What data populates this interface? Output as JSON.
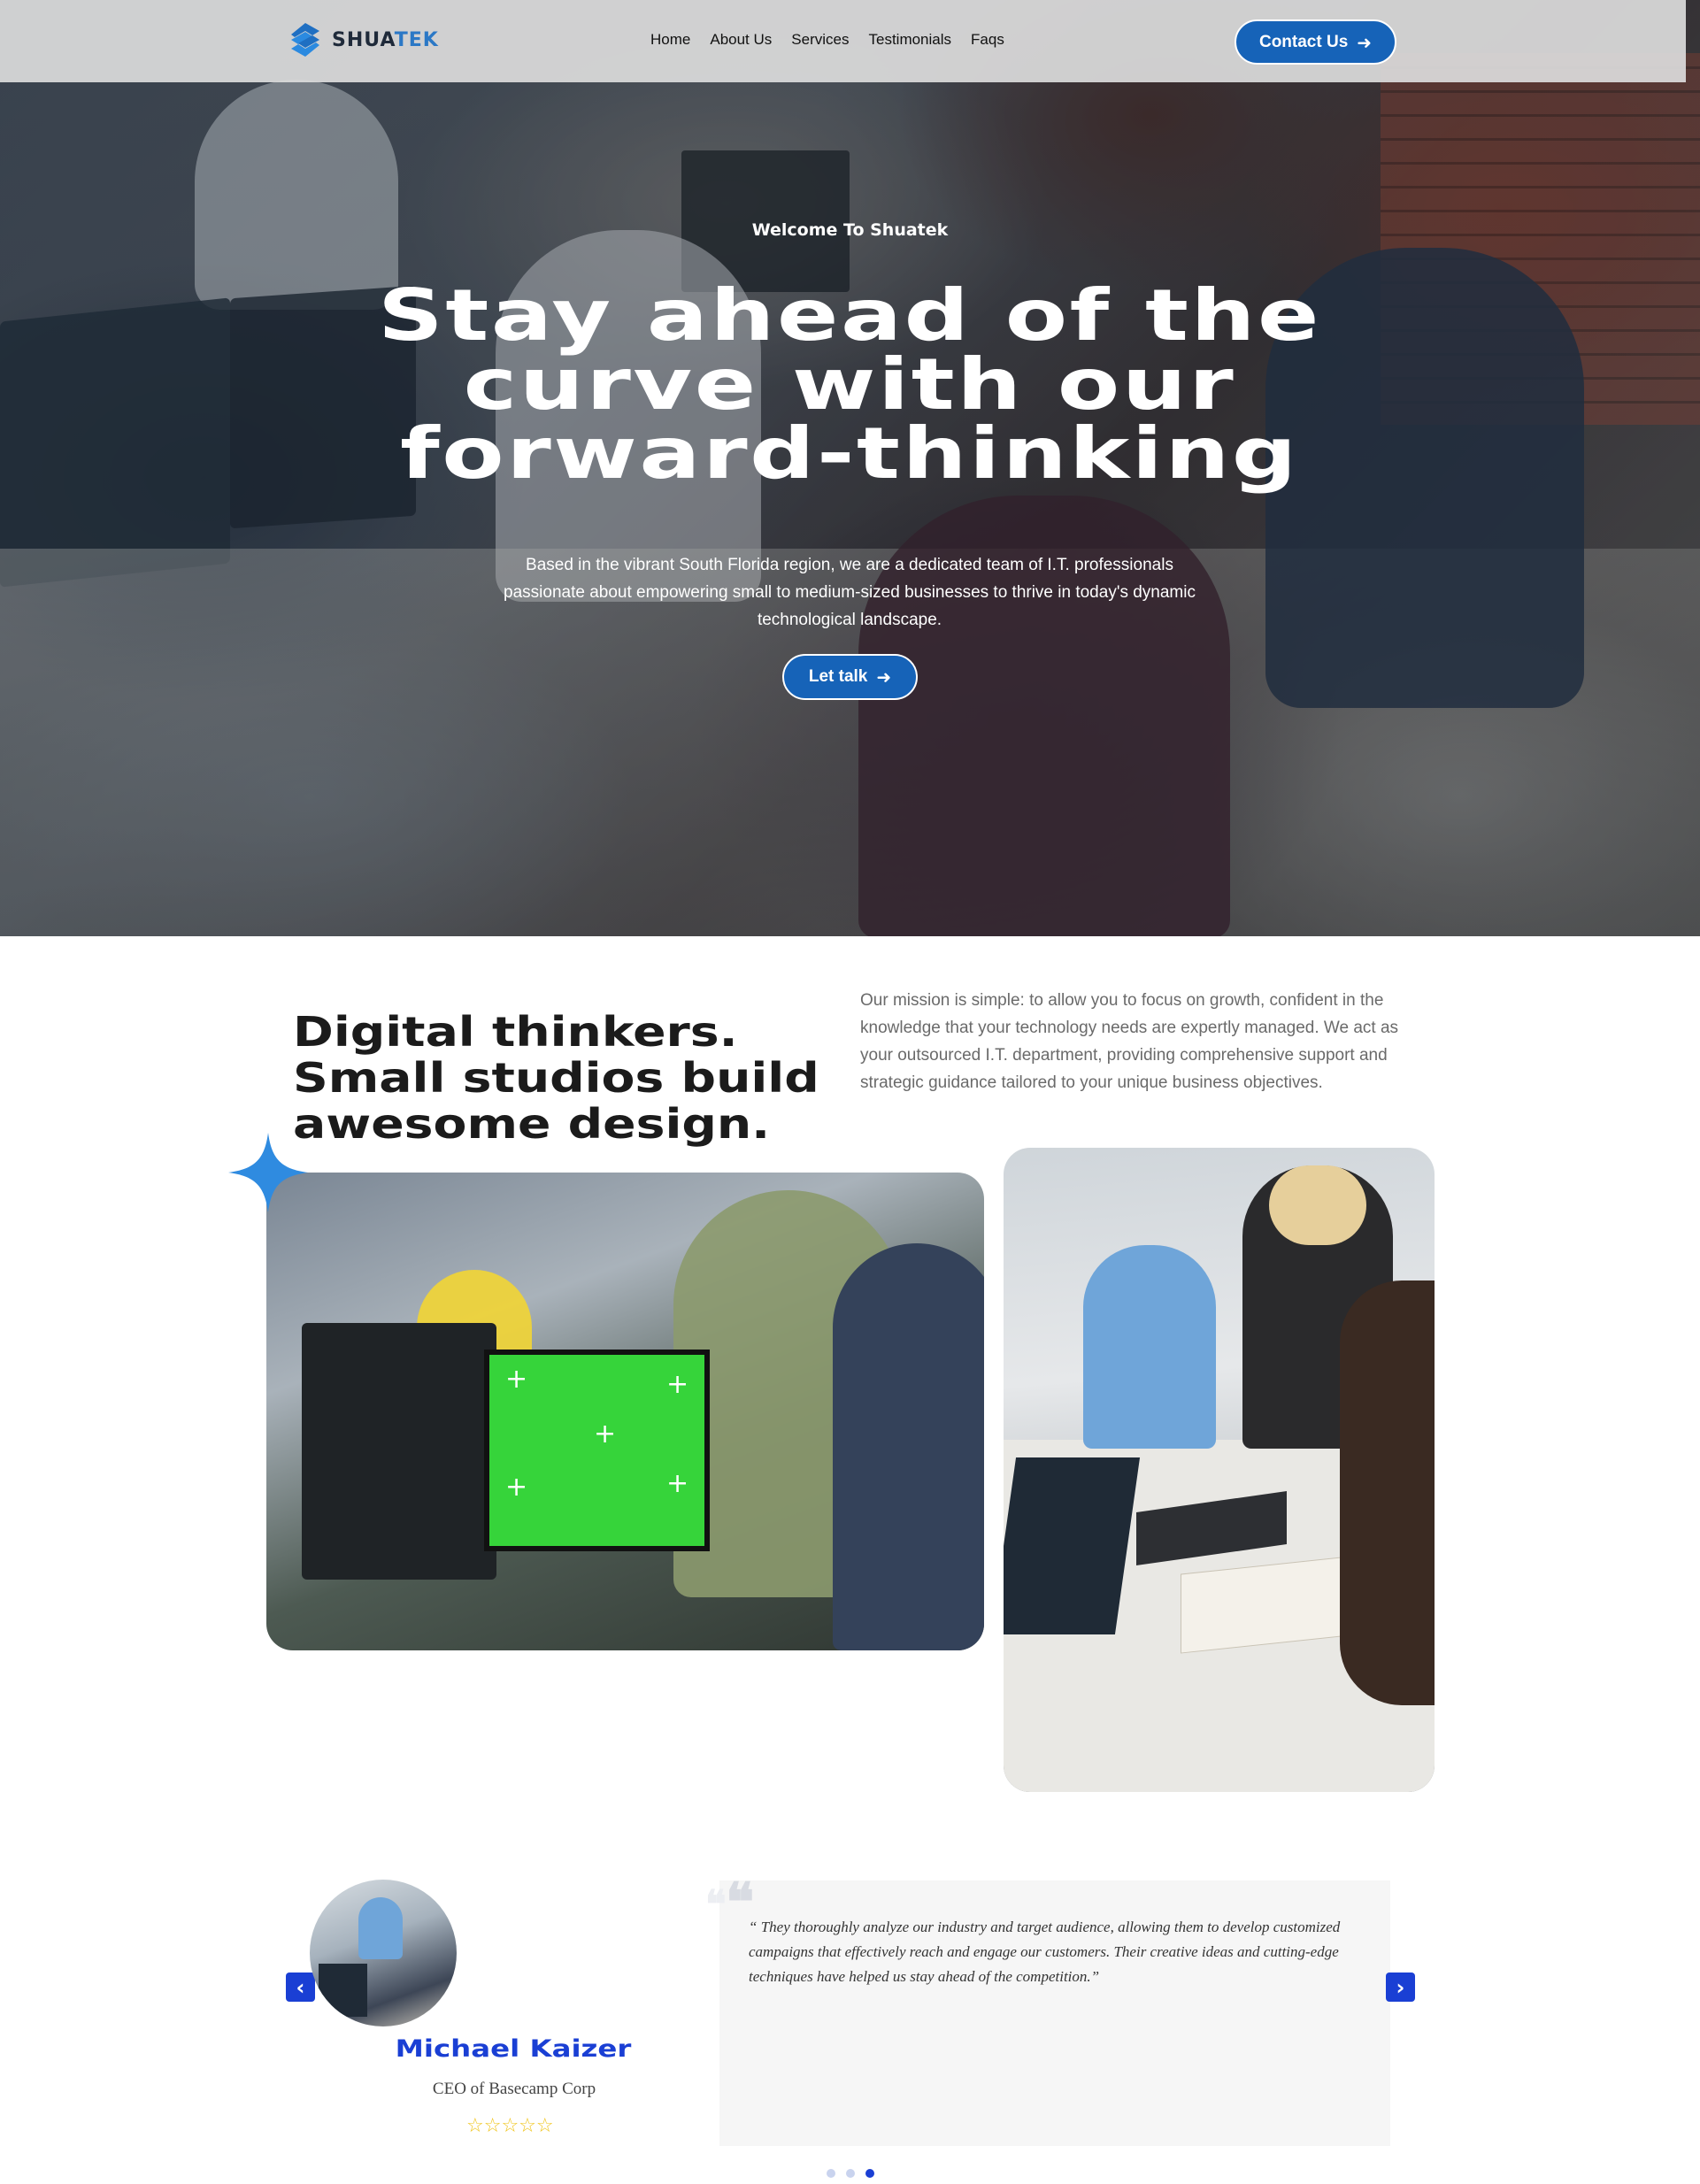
{
  "brand": {
    "name_dark": "SHUA",
    "name_accent": "TEK",
    "logo_icon": "shuatek-logo-icon"
  },
  "nav": {
    "items": [
      "Home",
      "About Us",
      "Services",
      "Testimonials",
      "Faqs"
    ]
  },
  "header": {
    "contact_label": "Contact Us",
    "contact_icon": "arrow-right-icon"
  },
  "hero": {
    "eyebrow": "Welcome To Shuatek",
    "title_line1": "Stay ahead of the",
    "title_line2": "curve with our",
    "title_line3": "forward-thinking",
    "description": "Based in the vibrant South Florida region, we are a dedicated team of I.T. professionals passionate about empowering small to medium-sized businesses to thrive in today's dynamic technological landscape.",
    "cta_label": "Let talk"
  },
  "about": {
    "title_line1": "Digital thinkers.",
    "title_line2": "Small studios build",
    "title_line3": "awesome design.",
    "text": "Our mission is simple: to allow you to focus on growth, confident in the knowledge that your technology needs are expertly managed. We act as your outsourced I.T. department, providing comprehensive support and strategic guidance tailored to your unique business objectives."
  },
  "testimonial": {
    "name": "Michael Kaizer",
    "role": "CEO of Basecamp Corp",
    "rating": 5,
    "stars": "☆☆☆☆☆",
    "quote": "“ They thoroughly analyze our industry and target audience, allowing them to develop customized campaigns that effectively reach and engage our customers. Their creative ideas and cutting-edge techniques have helped us stay ahead of the competition.”",
    "prev_icon": "‹",
    "next_icon": "›",
    "active_slide": 3,
    "slide_count": 3
  },
  "colors": {
    "accent": "#1663b8",
    "testimonial_blue": "#1a3fd4",
    "star": "#f0c419",
    "sparkle": "#2f8be0"
  }
}
